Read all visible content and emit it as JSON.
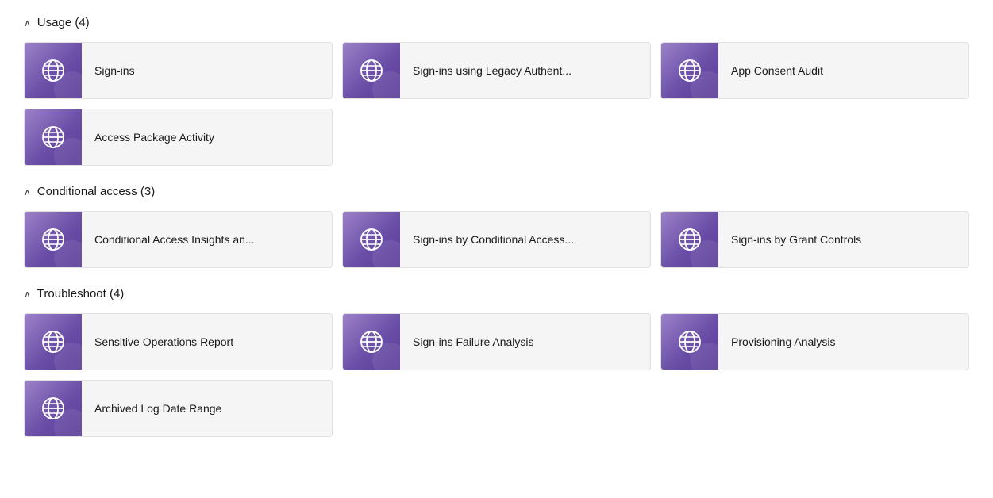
{
  "sections": [
    {
      "id": "usage",
      "label": "Usage (4)",
      "expanded": true,
      "items": [
        {
          "id": "sign-ins",
          "label": "Sign-ins"
        },
        {
          "id": "sign-ins-legacy",
          "label": "Sign-ins using Legacy Authent..."
        },
        {
          "id": "app-consent-audit",
          "label": "App Consent Audit"
        },
        {
          "id": "access-package-activity",
          "label": "Access Package Activity"
        }
      ]
    },
    {
      "id": "conditional-access",
      "label": "Conditional access (3)",
      "expanded": true,
      "items": [
        {
          "id": "conditional-access-insights",
          "label": "Conditional Access Insights an..."
        },
        {
          "id": "sign-ins-by-conditional-access",
          "label": "Sign-ins by Conditional Access..."
        },
        {
          "id": "sign-ins-by-grant-controls",
          "label": "Sign-ins by Grant Controls"
        }
      ]
    },
    {
      "id": "troubleshoot",
      "label": "Troubleshoot (4)",
      "expanded": true,
      "items": [
        {
          "id": "sensitive-operations-report",
          "label": "Sensitive Operations Report"
        },
        {
          "id": "sign-ins-failure-analysis",
          "label": "Sign-ins Failure Analysis"
        },
        {
          "id": "provisioning-analysis",
          "label": "Provisioning Analysis"
        },
        {
          "id": "archived-log-date-range",
          "label": "Archived Log Date Range"
        }
      ]
    }
  ]
}
